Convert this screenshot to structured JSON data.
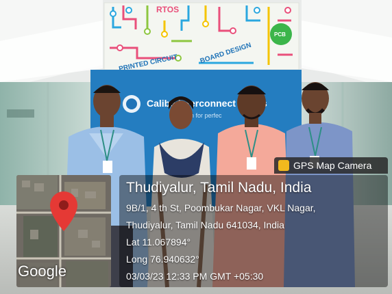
{
  "backdrop": {
    "board_rtos": "RTOS",
    "board_pcb": "PCB",
    "board_printed_circuit": "PRINTED CIRCUIT",
    "board_design": "BOARD DESIGN",
    "banner_company": "Calibe  Interconnect  utions",
    "banner_tagline": "n  for  perfec"
  },
  "gps_overlay": {
    "app_name": "GPS Map Camera",
    "place_title": "Thudiyalur, Tamil Nadu, India",
    "address_line1": "9B/1, 4 th St, Poombukar Nagar, VKL Nagar,",
    "address_line2": "Thudiyalur, Tamil Nadu 641034, India",
    "latitude": "Lat 11.067894°",
    "longitude": "Long 76.940632°",
    "datetime": "03/03/23 12:33 PM GMT +05:30",
    "map_brand": "Google"
  },
  "colors": {
    "banner_blue": "#1f73b7",
    "board_bg": "#f4f6f1",
    "pin_red": "#e53935",
    "overlay_text": "#ffffff"
  }
}
